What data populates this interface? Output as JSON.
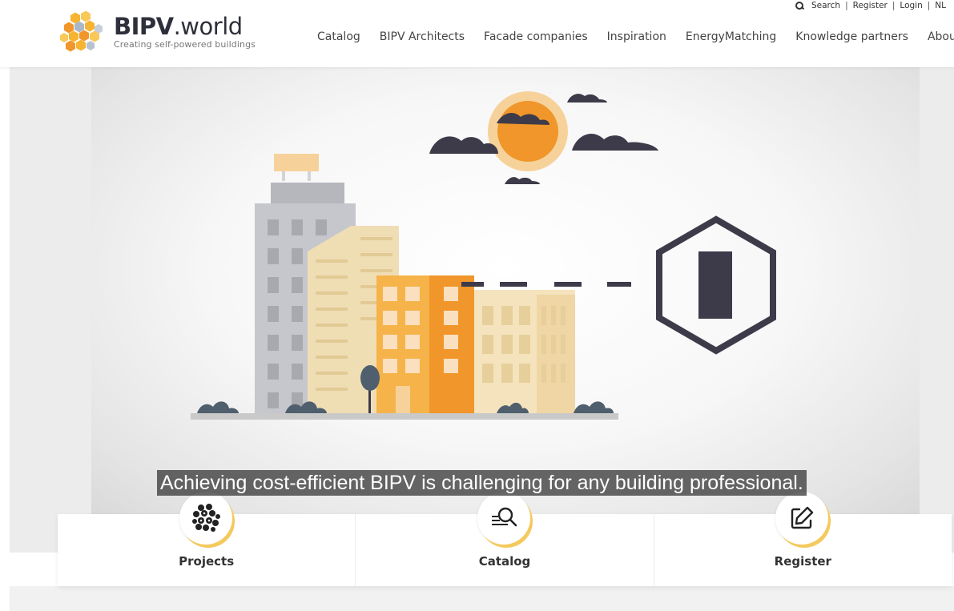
{
  "brand": {
    "name_bold": "BIPV",
    "name_rest": ".world",
    "tagline": "Creating self-powered buildings"
  },
  "topbar": {
    "search": "Search",
    "register": "Register",
    "login": "Login",
    "language": "NL",
    "separator": "|"
  },
  "nav": {
    "items": [
      {
        "label": "Catalog"
      },
      {
        "label": "BIPV Architects"
      },
      {
        "label": "Facade companies"
      },
      {
        "label": "Inspiration"
      },
      {
        "label": "EnergyMatching"
      },
      {
        "label": "Knowledge partners"
      },
      {
        "label": "About us"
      }
    ]
  },
  "hero": {
    "caption": "Achieving cost-efficient BIPV is challenging for any building professional."
  },
  "cards": [
    {
      "label": "Projects",
      "icon": "projects-hexagon-icon"
    },
    {
      "label": "Catalog",
      "icon": "catalog-search-icon"
    },
    {
      "label": "Register",
      "icon": "edit-icon"
    }
  ],
  "colors": {
    "accent_orange": "#f0962a",
    "accent_yellow": "#f4c95d",
    "dark_slate": "#3d3b4a",
    "left_strip_blue": "#1e7fd8"
  }
}
